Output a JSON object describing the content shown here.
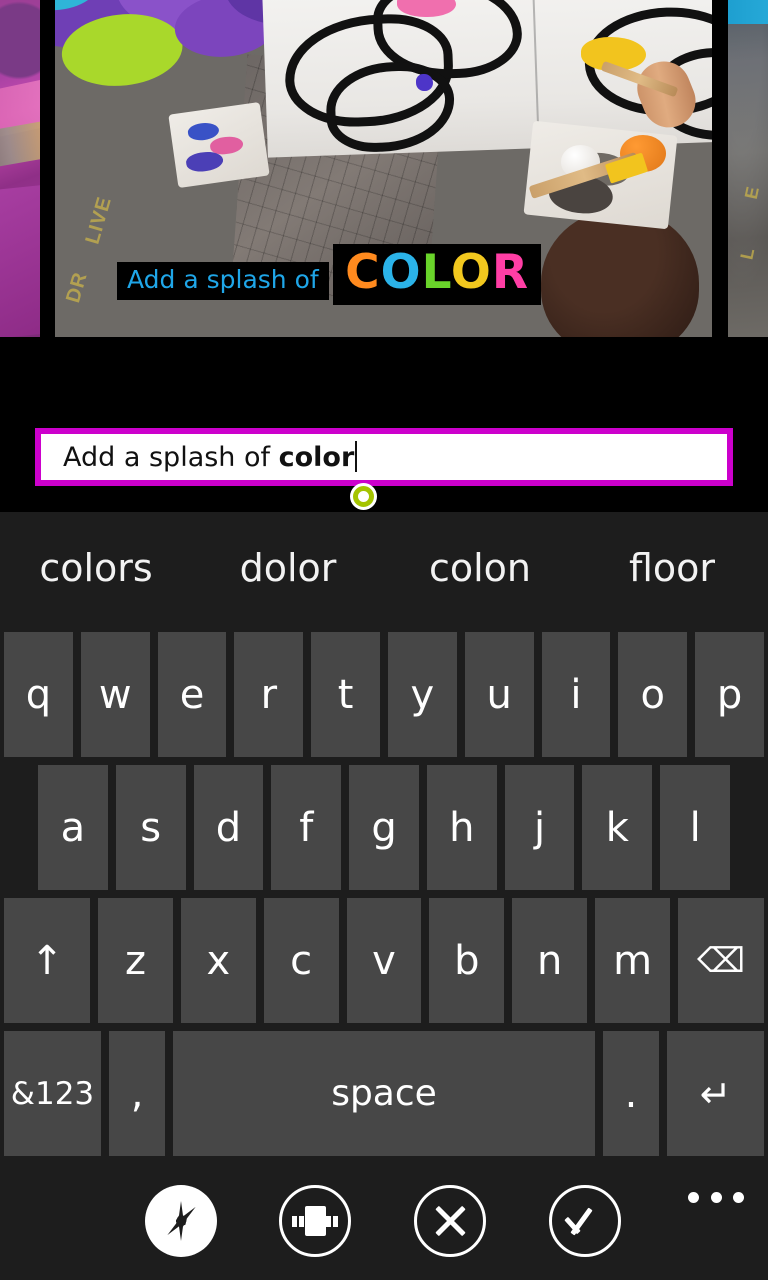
{
  "photo_overlay": {
    "caption_line1": "Add a splash of",
    "caption_line2_letters": [
      {
        "char": "C",
        "color": "#ff8a1e"
      },
      {
        "char": "O",
        "color": "#2bb3e8"
      },
      {
        "char": "L",
        "color": "#69d42a"
      },
      {
        "char": "O",
        "color": "#f2c81e"
      },
      {
        "char": "R",
        "color": "#ff3ea5"
      }
    ],
    "caption_line1_color": "#1fa6e8",
    "caption_background": "#000000"
  },
  "text_input": {
    "value_plain": "Add a splash of ",
    "value_bold": "color",
    "border_color": "#cc00cc",
    "handle_color": "#a4c400",
    "caret_visible": true
  },
  "keyboard": {
    "suggestions": [
      "colors",
      "dolor",
      "colon",
      "floor"
    ],
    "row1": [
      "q",
      "w",
      "e",
      "r",
      "t",
      "y",
      "u",
      "i",
      "o",
      "p"
    ],
    "row2": [
      "a",
      "s",
      "d",
      "f",
      "g",
      "h",
      "j",
      "k",
      "l"
    ],
    "row3_shift_label": "↑",
    "row3": [
      "z",
      "x",
      "c",
      "v",
      "b",
      "n",
      "m"
    ],
    "row3_backspace_label": "⌫",
    "row4": {
      "symbols_label": "&123",
      "comma_label": ",",
      "space_label": "space",
      "period_label": ".",
      "enter_label": "↵"
    },
    "key_color": "#474747",
    "background_color": "#1d1d1d"
  },
  "appbar": {
    "effects_label": "effects",
    "animate_label": "animate",
    "cancel_label": "cancel",
    "accept_label": "accept",
    "more_label": "more options"
  }
}
